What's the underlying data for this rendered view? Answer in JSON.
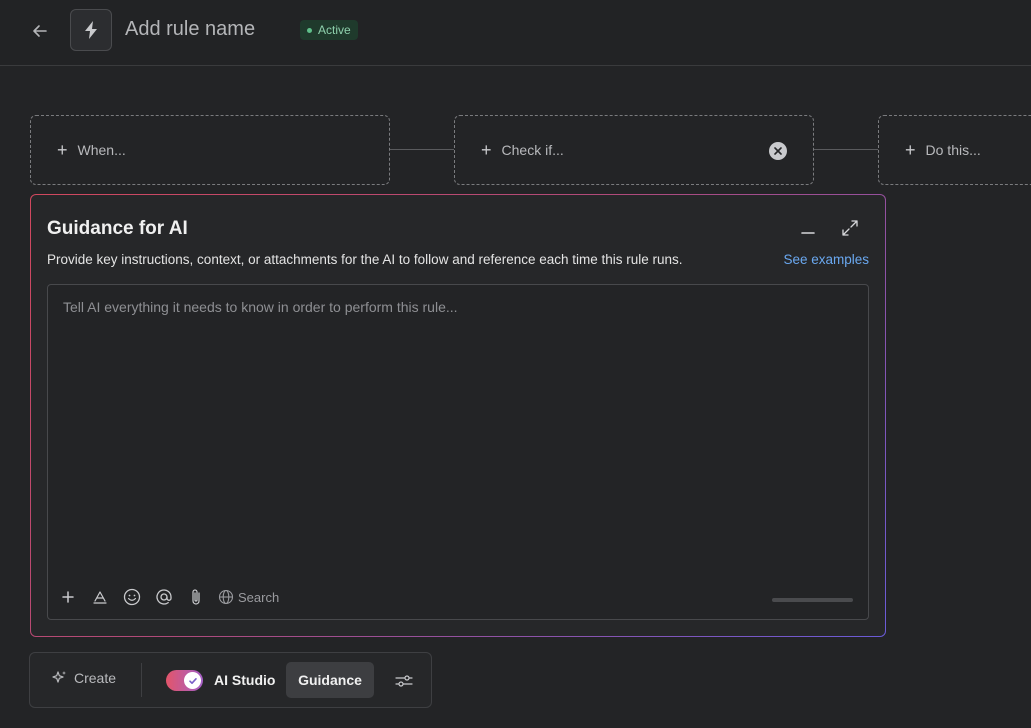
{
  "header": {
    "back_icon": "arrow-left-icon",
    "rule_icon": "lightning-bolt-icon",
    "title": "Add rule name",
    "status": "Active",
    "status_color": "#5fbf8a"
  },
  "steps": [
    {
      "label": "When...",
      "icon": "plus-icon"
    },
    {
      "label": "Check if...",
      "icon": "plus-icon",
      "clear_icon": "close-circle-icon"
    },
    {
      "label": "Do this...",
      "icon": "plus-icon"
    }
  ],
  "guidance": {
    "title": "Guidance for AI",
    "description": "Provide key instructions, context, or attachments for the AI to follow and reference each time this rule runs.",
    "see_examples": "See examples",
    "editor_placeholder": "Tell AI everything it needs to know in order to perform this rule...",
    "toolbar": {
      "icons": [
        "plus-icon",
        "text-format-icon",
        "emoji-icon",
        "mention-icon",
        "attachment-icon",
        "globe-icon"
      ],
      "search_label": "Search"
    },
    "accent_gradient": [
      "#d0485e",
      "#6a5bd8"
    ]
  },
  "bottom_bar": {
    "create_label": "Create",
    "create_icon": "sparkle-icon",
    "toggle_on": true,
    "ai_studio_label": "AI Studio",
    "guidance_label": "Guidance",
    "settings_icon": "sliders-icon"
  }
}
